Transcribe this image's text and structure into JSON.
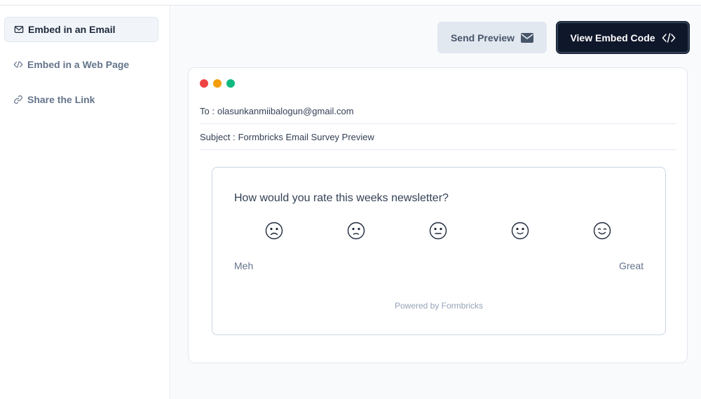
{
  "sidebar": {
    "items": [
      {
        "label": "Embed in an Email",
        "icon": "mail-icon",
        "active": true
      },
      {
        "label": "Embed in a Web Page",
        "icon": "code-icon",
        "active": false
      },
      {
        "label": "Share the Link",
        "icon": "link-icon",
        "active": false
      }
    ]
  },
  "toolbar": {
    "send_preview_label": "Send Preview",
    "send_preview_icon": "envelope-icon",
    "view_embed_label": "View Embed Code",
    "view_embed_icon": "code-icon"
  },
  "email": {
    "window_dots": [
      "#ef4444",
      "#f59e0b",
      "#10b981"
    ],
    "to_label": "To :",
    "to_value": "olasunkanmiibalogun@gmail.com",
    "subject_label": "Subject :",
    "subject_value": "Formbricks Email Survey Preview"
  },
  "survey": {
    "question": "How would you rate this weeks newsletter?",
    "faces": [
      "very-sad-face-icon",
      "sad-face-icon",
      "neutral-face-icon",
      "smile-face-icon",
      "very-happy-face-icon"
    ],
    "low_label": "Meh",
    "high_label": "Great",
    "powered_by": "Powered by Formbricks"
  },
  "colors": {
    "primary": "#0f172a",
    "secondary_button": "#e2e8f0",
    "main_background": "#f8fafc"
  }
}
